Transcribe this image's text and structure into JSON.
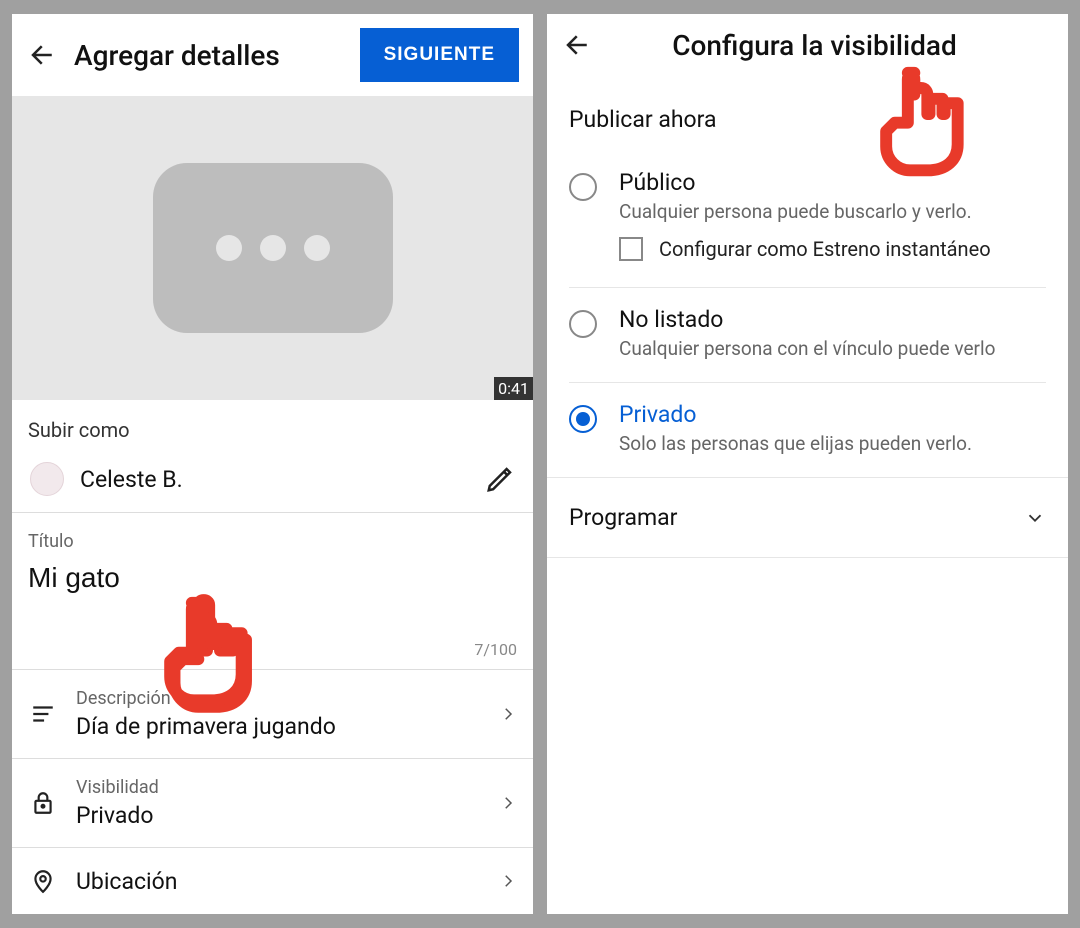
{
  "left": {
    "header": {
      "title": "Agregar detalles",
      "next": "SIGUIENTE"
    },
    "duration": "0:41",
    "upload_as_label": "Subir como",
    "username": "Celeste B.",
    "title_field": {
      "label": "Título",
      "value": "Mi gato",
      "counter": "7/100"
    },
    "rows": {
      "description": {
        "label": "Descripción",
        "value": "Día de primavera jugando"
      },
      "visibility": {
        "label": "Visibilidad",
        "value": "Privado"
      },
      "location": {
        "label": "Ubicación"
      }
    }
  },
  "right": {
    "header": {
      "title": "Configura la visibilidad"
    },
    "publish_now": "Publicar ahora",
    "options": {
      "public": {
        "title": "Público",
        "desc": "Cualquier persona puede buscarlo y verlo."
      },
      "premiere_label": "Configurar como Estreno instantáneo",
      "unlisted": {
        "title": "No listado",
        "desc": "Cualquier persona con el vínculo puede verlo"
      },
      "private": {
        "title": "Privado",
        "desc": "Solo las personas que elijas pueden verlo."
      }
    },
    "schedule": "Programar"
  }
}
